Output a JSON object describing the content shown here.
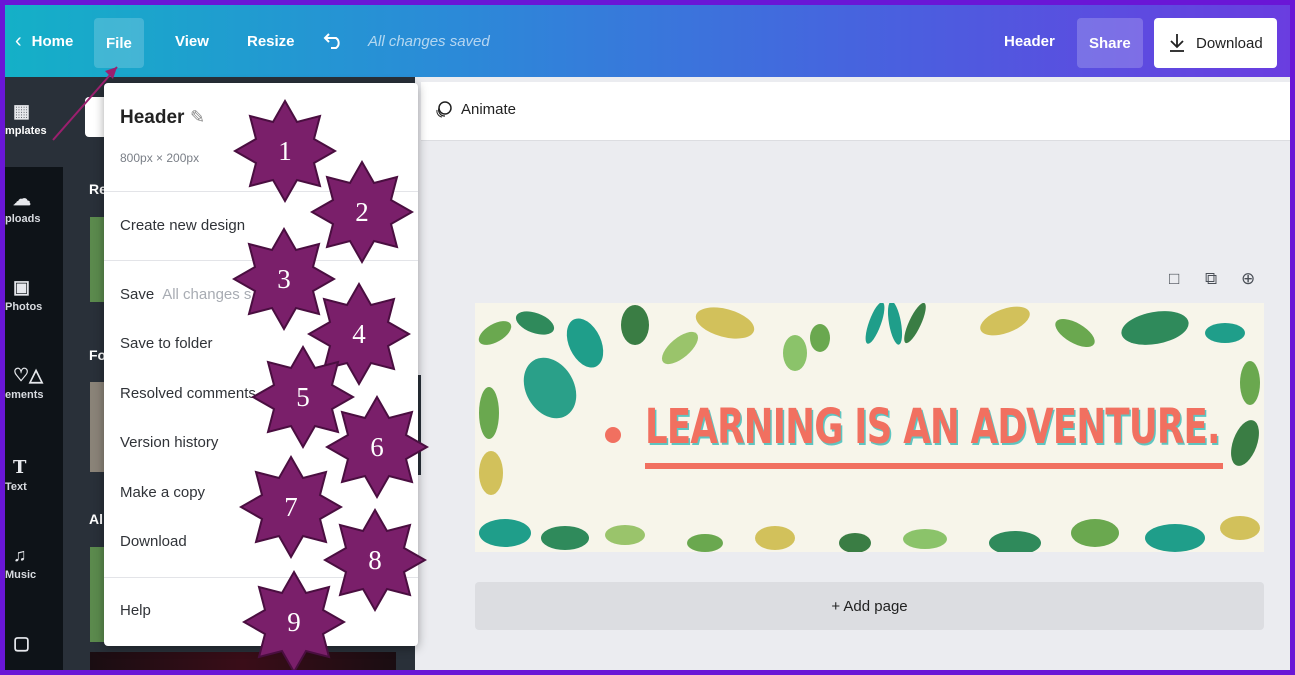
{
  "topbar": {
    "home": "Home",
    "file": "File",
    "view": "View",
    "resize": "Resize",
    "saved_status": "All changes saved",
    "design_name": "Header",
    "share": "Share",
    "download": "Download"
  },
  "sidebar": {
    "items": [
      {
        "label": "mplates",
        "icon": "templates-icon"
      },
      {
        "label": "ploads",
        "icon": "uploads-icon"
      },
      {
        "label": "Photos",
        "icon": "photos-icon"
      },
      {
        "label": "ements",
        "icon": "elements-icon"
      },
      {
        "label": "Text",
        "icon": "text-icon"
      },
      {
        "label": "Music",
        "icon": "music-icon"
      },
      {
        "label": "",
        "icon": "video-icon"
      }
    ]
  },
  "panel": {
    "section_1": "Re",
    "section_2": "Fo",
    "section_3": "Al"
  },
  "file_menu": {
    "title": "Header",
    "dimensions": "800px × 200px",
    "create_new": "Create new design",
    "save": "Save",
    "save_status": "All changes s",
    "save_to_folder": "Save to folder",
    "resolved_comments": "Resolved comments",
    "version_history": "Version history",
    "make_copy": "Make a copy",
    "download": "Download",
    "help": "Help"
  },
  "workspace": {
    "animate": "Animate",
    "headline": "LEARNING IS AN ADVENTURE.",
    "add_page": "+ Add page"
  },
  "annotations": [
    "1",
    "2",
    "3",
    "4",
    "5",
    "6",
    "7",
    "8",
    "9"
  ],
  "colors": {
    "frame": "#6a16d6",
    "star": "#7a1f6a",
    "headline": "#f17060",
    "headline_shadow": "#5ec5c1"
  }
}
